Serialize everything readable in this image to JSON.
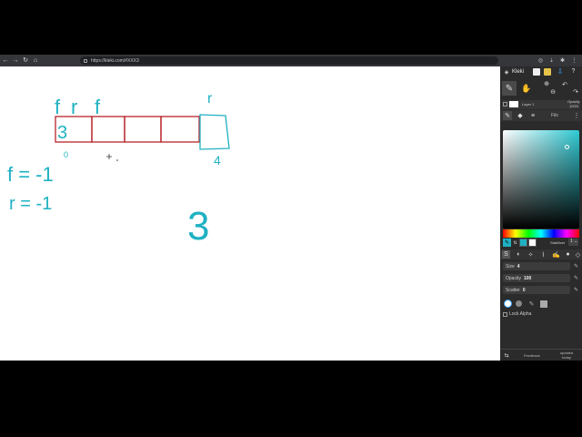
{
  "browser": {
    "url": "https://kleki.com/#XXX3",
    "nav": [
      "back-icon",
      "forward-icon",
      "reload-icon",
      "home-icon"
    ]
  },
  "canvas": {
    "array_cells": [
      "3",
      "",
      "",
      ""
    ],
    "top_labels": [
      "f",
      "r",
      "f",
      "r"
    ],
    "index_labels": [
      "0",
      "4"
    ],
    "notes": [
      "f = -1",
      "r = -1"
    ],
    "big_number": "3",
    "ink_color": "#1fb1c2",
    "cell_color": "#b8242b"
  },
  "panel": {
    "app_name": "Kleki",
    "layer_label": "Layer 1",
    "opacity_label": "Opacity",
    "opacity_value": "100%",
    "tabs": [
      "brush-tab",
      "layers-tab",
      "adjust-tab"
    ],
    "file_label": "File",
    "stabilizer_label": "Stabilizer",
    "stabilizer_value": "1",
    "size_label": "Size",
    "size_value": "4",
    "opacity2_label": "Opacity",
    "opacity2_value": "100",
    "scatter_label": "Scatter",
    "scatter_value": "0",
    "lock_alpha_label": "Lock Alpha",
    "feedback_label": "Feedback",
    "updated_label": "updated today",
    "primary_color": "#1fb1c2",
    "secondary_color": "#ffffff"
  }
}
